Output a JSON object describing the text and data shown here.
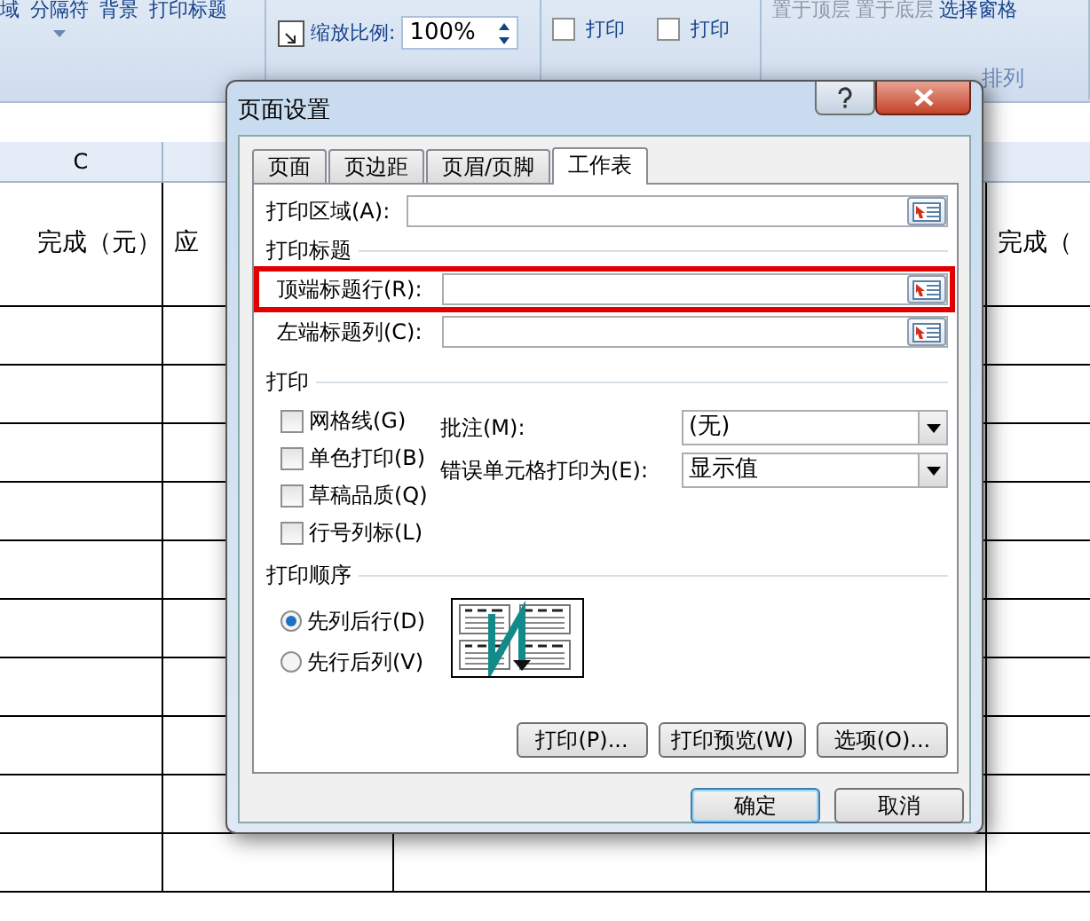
{
  "ribbon": {
    "top_labels": [
      {
        "text": "域",
        "disabled": false
      },
      {
        "text": "分隔符",
        "disabled": false
      },
      {
        "text": "背景",
        "disabled": false
      },
      {
        "text": "打印标题",
        "disabled": false
      },
      {
        "text": "置于顶层",
        "disabled": true
      },
      {
        "text": "置于底层",
        "disabled": true
      },
      {
        "text": "选择窗格",
        "disabled": false
      }
    ],
    "scale_label": "缩放比例:",
    "scale_value": "100%",
    "sheet_options": [
      {
        "label": "打印",
        "checked": false
      },
      {
        "label": "打印",
        "checked": false
      }
    ],
    "group_label": "排列"
  },
  "sheet": {
    "column_header": "C",
    "header_cells": [
      "完成（元）",
      "应",
      "",
      "完成（"
    ]
  },
  "dialog": {
    "title": "页面设置",
    "tabs": [
      {
        "label": "页面",
        "selected": false
      },
      {
        "label": "页边距",
        "selected": false
      },
      {
        "label": "页眉/页脚",
        "selected": false
      },
      {
        "label": "工作表",
        "selected": true
      }
    ],
    "print_area": {
      "label": "打印区域(A):"
    },
    "print_titles": {
      "heading": "打印标题",
      "fields": [
        {
          "label": "顶端标题行(R):",
          "highlighted": true
        },
        {
          "label": "左端标题列(C):",
          "highlighted": false
        }
      ]
    },
    "print": {
      "heading": "打印",
      "options": [
        {
          "label": "网格线(G)",
          "checked": false
        },
        {
          "label": "单色打印(B)",
          "checked": false
        },
        {
          "label": "草稿品质(Q)",
          "checked": false
        },
        {
          "label": "行号列标(L)",
          "checked": false
        }
      ],
      "selects": [
        {
          "label": "批注(M):",
          "value": "(无)"
        },
        {
          "label": "错误单元格打印为(E):",
          "value": "显示值"
        }
      ]
    },
    "page_order": {
      "heading": "打印顺序",
      "options": [
        {
          "label": "先列后行(D)",
          "selected": true
        },
        {
          "label": "先行后列(V)",
          "selected": false
        }
      ]
    },
    "panel_buttons": [
      "打印(P)...",
      "打印预览(W)",
      "选项(O)..."
    ],
    "buttons": [
      {
        "label": "确定",
        "default": true
      },
      {
        "label": "取消",
        "default": false
      }
    ]
  }
}
